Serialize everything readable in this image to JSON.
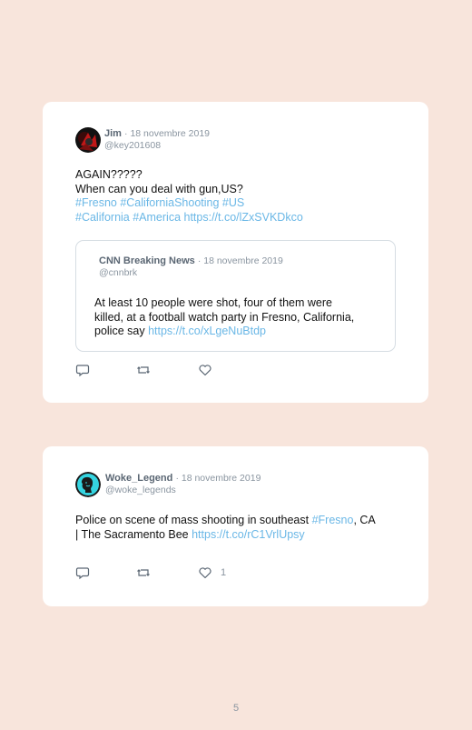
{
  "tweets": [
    {
      "author": "Jim",
      "date": "· 18 novembre 2019",
      "handle": "@key201608",
      "lines": [
        [
          {
            "t": "AGAIN?????",
            "link": false
          }
        ],
        [
          {
            "t": "When can you deal with gun,US?",
            "link": false
          }
        ],
        [
          {
            "t": "#Fresno #CaliforniaShooting #US",
            "link": true
          }
        ],
        [
          {
            "t": "#California #America https://t.co/lZxSVKDkco",
            "link": true
          }
        ]
      ],
      "quoted": {
        "author": "CNN Breaking News",
        "date": "· 18 novembre 2019",
        "handle": "@cnnbrk",
        "lines": [
          [
            {
              "t": "At least 10 people were shot, four of them were",
              "link": false
            }
          ],
          [
            {
              "t": "killed, at a football watch party in Fresno, California,",
              "link": false
            }
          ],
          [
            {
              "t": "police say ",
              "link": false
            },
            {
              "t": "https://t.co/xLgeNuBtdp",
              "link": true
            }
          ]
        ]
      },
      "like_count": ""
    },
    {
      "author": "Woke_Legend",
      "date": "· 18 novembre 2019",
      "handle": "@woke_legends",
      "lines": [
        [
          {
            "t": "Police on scene of mass shooting in southeast ",
            "link": false
          },
          {
            "t": "#Fresno",
            "link": true
          },
          {
            "t": ", CA",
            "link": false
          }
        ],
        [
          {
            "t": "| The Sacramento Bee ",
            "link": false
          },
          {
            "t": "https://t.co/rC1VrlUpsy",
            "link": true
          }
        ]
      ],
      "like_count": "1"
    }
  ],
  "icons": {
    "reply": "reply-icon",
    "retweet": "retweet-icon",
    "like": "heart-icon"
  },
  "colors": {
    "background": "#f8e5dc",
    "card": "#ffffff",
    "link": "#6ab7e6",
    "muted": "#8a95a0"
  },
  "page_number": "5"
}
